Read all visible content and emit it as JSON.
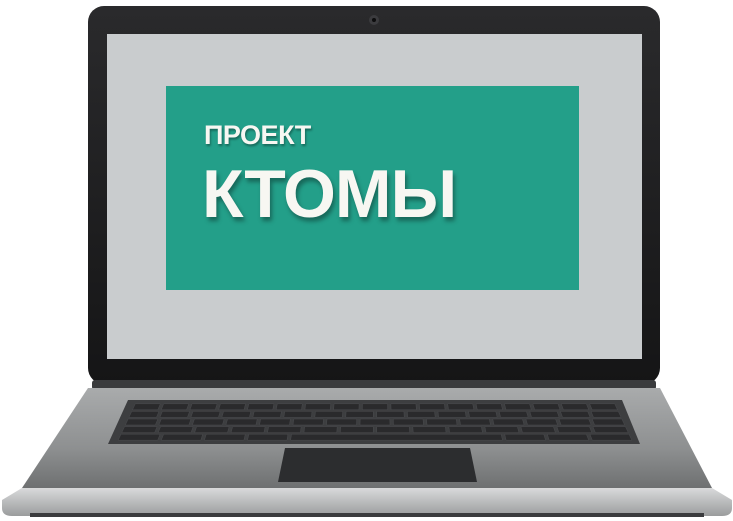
{
  "screen_content": {
    "logo": {
      "line1": "ПРОЕКТ",
      "line2": "КТОМЫ"
    },
    "colors": {
      "panel_background": "#239f89",
      "logo_text": "#f7f7f2",
      "screen_background": "#c9ccce",
      "bezel": "#1d1d1f",
      "deck": "#8f9192",
      "keys": "#2a2a2c"
    }
  },
  "icons": {
    "device": "laptop-icon",
    "camera": "webcam-icon"
  }
}
